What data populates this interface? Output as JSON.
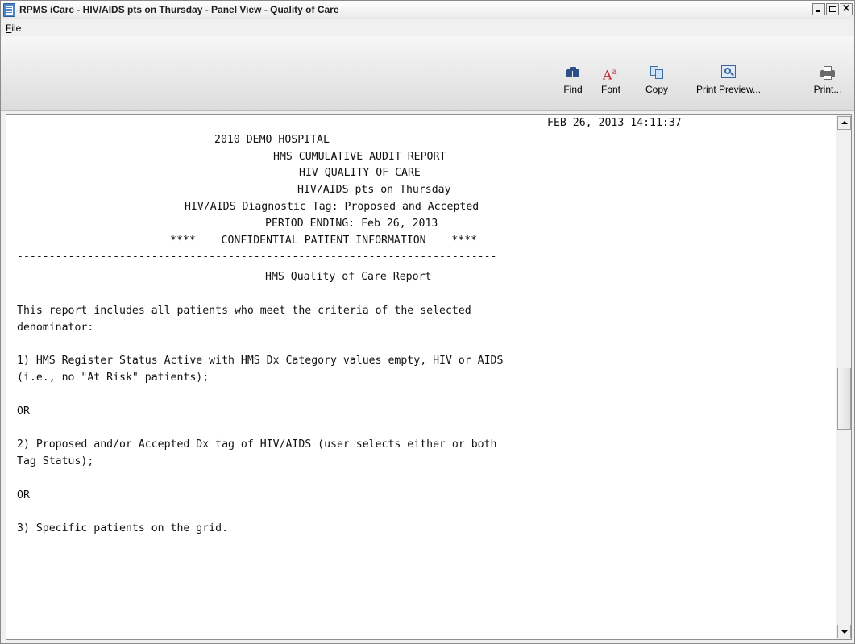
{
  "window": {
    "title": "RPMS iCare - HIV/AIDS pts on Thursday - Panel View - Quality of Care",
    "minimize_glyph": "_",
    "maximize_glyph": "□",
    "close_glyph": "×"
  },
  "menu": {
    "items": [
      {
        "label": "File"
      }
    ]
  },
  "toolbar": {
    "buttons": [
      {
        "label": "Find",
        "icon": "binoculars-icon"
      },
      {
        "label": "Font",
        "icon": "font-icon"
      },
      {
        "label": "Copy",
        "icon": "copy-icon"
      },
      {
        "label": "Print Preview...",
        "icon": "print-preview-icon"
      },
      {
        "label": "Print...",
        "icon": "printer-icon"
      }
    ]
  },
  "report": {
    "timestamp": "FEB 26, 2013 14:11:37",
    "facility": "2010 DEMO HOSPITAL",
    "report_name": "HMS CUMULATIVE AUDIT REPORT",
    "report_subtitle": "HIV QUALITY OF CARE",
    "panel_name": "HIV/AIDS pts on Thursday",
    "diagnostic_tag": "HIV/AIDS Diagnostic Tag: Proposed and Accepted",
    "period": "PERIOD ENDING: Feb 26, 2013",
    "confidential": "****    CONFIDENTIAL PATIENT INFORMATION    ****",
    "divider": "---------------------------------------------------------------------------",
    "section_title": "HMS Quality of Care Report",
    "intro_line1": "This report includes all patients who meet the criteria of the selected",
    "intro_line2": "denominator:",
    "criterion1_line1": "1) HMS Register Status Active with HMS Dx Category values empty, HIV or AIDS",
    "criterion1_line2": "(i.e., no \"At Risk\" patients);",
    "or_1": "OR",
    "criterion2_line1": "2) Proposed and/or Accepted Dx tag of HIV/AIDS (user selects either or both",
    "criterion2_line2": "Tag Status);",
    "or_2": "OR",
    "criterion3": "3) Specific patients on the grid."
  },
  "scrollbar": {
    "thumb_position": 0.55
  }
}
